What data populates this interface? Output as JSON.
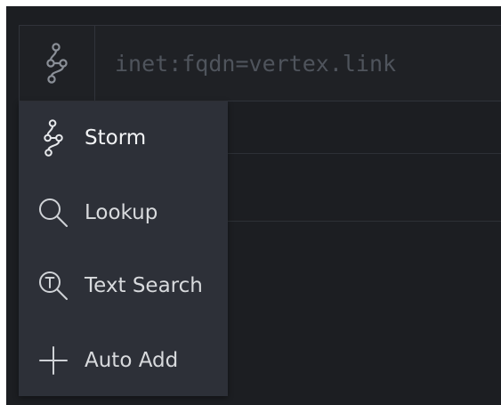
{
  "query_bar": {
    "mode_icon": "storm-icon",
    "placeholder": "inet:fqdn=vertex.link"
  },
  "mode_menu": {
    "items": [
      {
        "label": "Storm",
        "icon": "storm-icon",
        "selected": true
      },
      {
        "label": "Lookup",
        "icon": "search-icon",
        "selected": false
      },
      {
        "label": "Text Search",
        "icon": "text-search-icon",
        "selected": false
      },
      {
        "label": "Auto Add",
        "icon": "plus-icon",
        "selected": false
      }
    ]
  },
  "colors": {
    "background": "#1c1e22",
    "menu_background": "#2d3038",
    "border": "#30333a",
    "placeholder_text": "#4f545c",
    "menu_text": "#d8dadd",
    "icon_stroke": "#d0d3d8"
  }
}
